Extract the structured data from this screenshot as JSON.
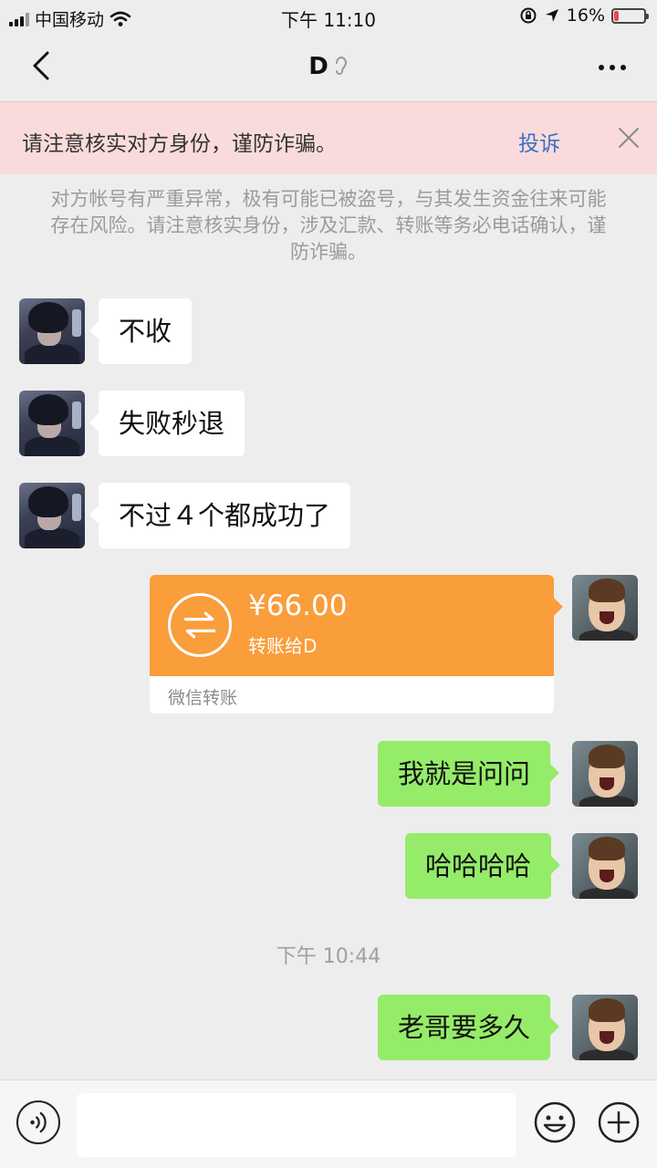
{
  "status_bar": {
    "carrier": "中国移动",
    "time": "下午 11:10",
    "battery": "16%",
    "battery_level": 0.16,
    "icons": [
      "signal-icon",
      "wifi-icon",
      "rotation-lock-icon",
      "location-arrow-icon",
      "battery-icon"
    ]
  },
  "nav": {
    "title": "D",
    "icons": [
      "back-chevron-icon",
      "ear-icon",
      "more-dots-icon"
    ]
  },
  "banner": {
    "text": "请注意核实对方身份，谨防诈骗。",
    "link": "投诉",
    "icons": [
      "close-icon"
    ]
  },
  "system_note": "对方帐号有严重异常，极有可能已被盗号，与其发生资金往来可能存在风险。请注意核实身份，涉及汇款、转账等务必电话确认，谨防诈骗。",
  "messages": {
    "m1": "不收",
    "m2": "失败秒退",
    "m3": "不过４个都成功了",
    "transfer": {
      "amount": "¥66.00",
      "to": "转账给D",
      "label": "微信转账",
      "color": "#fa9d3b"
    },
    "m4": "我就是问问",
    "m5": "哈哈哈哈",
    "timestamp": "下午 10:44",
    "m6": "老哥要多久"
  },
  "input_bar": {
    "placeholder": "",
    "icons": [
      "voice-icon",
      "emoji-icon",
      "plus-icon"
    ]
  },
  "colors": {
    "background": "#ededed",
    "outgoing_bubble": "#95ec69",
    "incoming_bubble": "#ffffff",
    "banner_bg": "#fadbdc",
    "link": "#3a70c6"
  }
}
